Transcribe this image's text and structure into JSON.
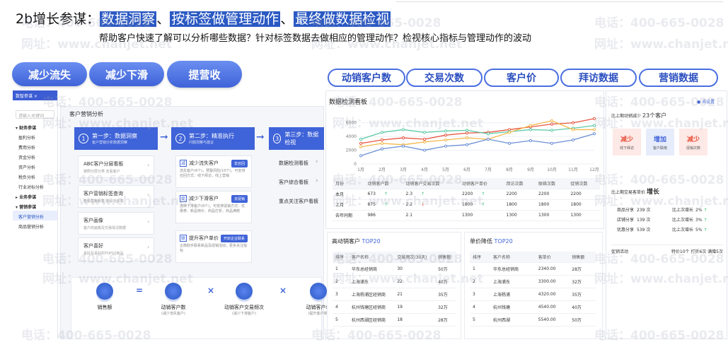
{
  "header": {
    "prefix": "2b增长参谋：",
    "hl1": "数据洞察",
    "sep1": "、",
    "hl2": "按标签做管理动作",
    "sep2": "、",
    "hl3": "最终做数据检视",
    "subtitle": "帮助客户快速了解可以分析哪些数据？针对标签数据去做相应的管理动作？检视核心指标与管理动作的波动"
  },
  "goals": [
    "减少流失",
    "减少下滑",
    "提营收"
  ],
  "metrics": [
    "动销客户数",
    "交易次数",
    "客户价",
    "拜访数据",
    "营销数据"
  ],
  "watermark": {
    "phone": "电话：400-665-0028",
    "site": "网址：www.chanjet.net"
  },
  "sidebar": {
    "header": "数智参谋 ×",
    "search": "请输入关键词",
    "items": [
      {
        "label": "▾ 财务参谋",
        "type": "grp"
      },
      {
        "label": "盈利分析",
        "type": "it"
      },
      {
        "label": "费用分析",
        "type": "it"
      },
      {
        "label": "资金分析",
        "type": "it"
      },
      {
        "label": "资产分析",
        "type": "it"
      },
      {
        "label": "税负分析",
        "type": "it"
      },
      {
        "label": "行业对标分析",
        "type": "it"
      },
      {
        "label": "▸ 业务参谋",
        "type": "grp"
      },
      {
        "label": "▾ 营销参谋",
        "type": "grp"
      },
      {
        "label": "客户营销分析",
        "type": "act"
      },
      {
        "label": "商品营销分析",
        "type": "it"
      }
    ]
  },
  "analysis": {
    "title": "客户营销分析",
    "step1": {
      "num": "1",
      "title": "第一步：数据洞察",
      "sub": "客户营销分析数据洞察"
    },
    "step2": {
      "num": "2",
      "title": "第二步：精准执行",
      "sub": "问题洞察与建议"
    },
    "step3": {
      "num": "3",
      "title": "第三步：数据检视"
    },
    "cards": [
      {
        "title": "ABC客户分层看板",
        "sub": "按照分层分类 去看客户"
      },
      {
        "title": "客户营销标签查询",
        "sub": "查看营销标签 去设定设置"
      },
      {
        "title": "客户画像",
        "sub": "客户的画像及交易情况数据"
      },
      {
        "title": "客户喜好",
        "sub": "喜好及喜好的TOP10商品"
      }
    ],
    "actions": [
      {
        "icon": "减",
        "title": "减少流失客户",
        "btn": "去召回",
        "desc": "流失客户(6个)，预警风险(10个)，可安排召回方式：线下拜访，线上营销"
      },
      {
        "icon": "促",
        "title": "减少下滑客户",
        "btn": "去促销",
        "desc": "连续下滑客户(8个)，可安排促销方式：优惠券、新品特价、商品打折、商品满赠"
      },
      {
        "icon": "联",
        "title": "提升客户单价",
        "btn": "开启企业联系",
        "desc": "企微助手联系新品及促销活动，更多关注指标"
      }
    ],
    "checks": [
      "数据检测看板",
      "客户综合看板",
      "重点关注客户看板"
    ]
  },
  "formula": {
    "items": [
      {
        "label": "销售额",
        "sub": ""
      },
      {
        "label": "动销客户数",
        "sub": "(减少流失客户)"
      },
      {
        "label": "动销客户交易频次",
        "sub": "(减少下滑客户)"
      },
      {
        "label": "动销客户单",
        "sub": "(提升客户单)"
      }
    ],
    "ops": [
      "=",
      "×",
      "×"
    ]
  },
  "dashboard": {
    "title": "数据检测看板",
    "settings": "去设置",
    "table": {
      "headers": [
        "月份",
        "动销客户数",
        "动销客户交易次数",
        "动销客户单价",
        "拜访次数",
        "联络次数",
        "促销次数"
      ],
      "rows": [
        {
          "m": "本月",
          "a": "673",
          "at": "↑",
          "b": "2.3",
          "bt": "↑",
          "c": "2200",
          "ct": "↑",
          "d": "2200",
          "e": "2200",
          "f": "2200"
        },
        {
          "m": "上月",
          "a": "875",
          "at": "↑",
          "b": "2.2",
          "bt": "↓",
          "c": "1800",
          "ct": "↑",
          "d": "1800",
          "e": "1800",
          "f": "1800"
        },
        {
          "m": "去年同期",
          "a": "986",
          "at": "",
          "b": "2.1",
          "bt": "",
          "c": "1300",
          "ct": "",
          "d": "1300",
          "e": "1300",
          "f": "1300"
        }
      ]
    }
  },
  "chart_data": {
    "type": "line",
    "categories": [
      "1月",
      "2月",
      "3月",
      "4月",
      "5月",
      "6月",
      "7月",
      "8月",
      "9月",
      "10月",
      "11月",
      "12月"
    ],
    "ylim": [
      0,
      7000
    ],
    "yticks": [
      0,
      2000,
      4000,
      6000
    ],
    "series": [
      {
        "color": "#e8553f",
        "values": [
          3000,
          3500,
          3800,
          3600,
          4200,
          4500,
          4600,
          5000,
          5400,
          5800,
          6000,
          6600
        ]
      },
      {
        "color": "#5cc9a7",
        "values": [
          3600,
          4600,
          5000,
          4600,
          4800,
          4900,
          4400,
          4700,
          5000,
          4900,
          5200,
          5600
        ]
      },
      {
        "color": "#f2b84b",
        "values": [
          2500,
          3000,
          2800,
          3200,
          3500,
          3800,
          3600,
          4600,
          5600,
          6300,
          5000,
          5000
        ]
      },
      {
        "color": "#6b8fd6",
        "values": [
          1200,
          2200,
          2600,
          2000,
          2600,
          2800,
          3600,
          3000,
          3400,
          3000,
          3500,
          4400
        ]
      }
    ]
  },
  "right_panel": {
    "line1_label": "比上期动销减少",
    "line1_value": "23个客户",
    "kpis": [
      {
        "title": "减少",
        "sub": "线下拜访",
        "color": "#e8553f",
        "bg": "#fde9e6"
      },
      {
        "title": "增加",
        "sub": "客户联络",
        "color": "#3f63d8",
        "bg": "#e7ecfb"
      },
      {
        "title": "减少",
        "sub": "促销次数",
        "color": "#e8553f",
        "bg": "#fde9e6"
      }
    ],
    "line2_label": "比上期交易客单价",
    "line2_value": "增长",
    "groups": [
      {
        "label": "商品分享",
        "val": "239 次",
        "cmp": "比上次增长",
        "pct": "2%"
      },
      {
        "label": "店铺分享",
        "val": "139 次",
        "cmp": "比上次增长",
        "pct": "3%"
      },
      {
        "label": "优惠分享",
        "val": "539 次",
        "cmp": "比上次增长",
        "pct": "5%"
      }
    ],
    "promo_label": "促销活动",
    "promo_value": "特价10个  打折6次  满赠5次"
  },
  "top_customers": {
    "title": "高动销客户",
    "badge": "TOP20",
    "headers": [
      "排序",
      "客户名称",
      "交易频次(30天)",
      "销售额"
    ],
    "rows": [
      [
        "1",
        "华东总经销商",
        "30",
        "50万"
      ],
      [
        "2",
        "上海浦东",
        "22",
        "40万"
      ],
      [
        "3",
        "上海杨浦区经销商",
        "21",
        "35万"
      ],
      [
        "4",
        "杭州钱塘区经销商",
        "19",
        "32万"
      ],
      [
        "5",
        "杭州西湖区经销商",
        "18",
        "28万"
      ]
    ]
  },
  "price_drop": {
    "title": "单价降低",
    "badge": "TOP20",
    "headers": [
      "排序",
      "客户名称",
      "客单价",
      "销售额"
    ],
    "rows": [
      [
        "1",
        "华东总经销商",
        "2340.00",
        "28万"
      ],
      [
        "2",
        "上海浦东",
        "3300.00",
        "32万"
      ],
      [
        "3",
        "上海杨浦",
        "4320.00",
        "35万"
      ],
      [
        "4",
        "杭州钱塘",
        "4540.00",
        "40万"
      ],
      [
        "5",
        "杭州西湖",
        "5540.00",
        "50万"
      ]
    ]
  }
}
